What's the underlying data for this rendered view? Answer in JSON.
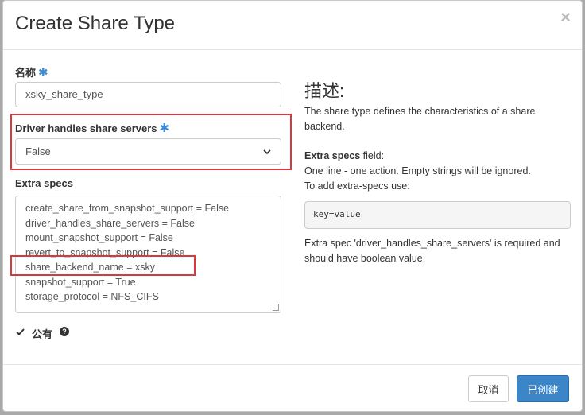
{
  "modal": {
    "title": "Create Share Type",
    "close_glyph": "×"
  },
  "form": {
    "name": {
      "label": "名称",
      "required_mark": "✱",
      "value": "xsky_share_type"
    },
    "driver_handles": {
      "label": "Driver handles share servers",
      "required_mark": "✱",
      "value": "False"
    },
    "extra_specs": {
      "label": "Extra specs",
      "lines": [
        "create_share_from_snapshot_support = False",
        "driver_handles_share_servers = False",
        "mount_snapshot_support = False",
        "revert_to_snapshot_support = False",
        "share_backend_name = xsky",
        "snapshot_support = True",
        "storage_protocol = NFS_CIFS"
      ]
    },
    "public": {
      "label": "公有",
      "checked_glyph": "☑",
      "help_glyph": "?"
    }
  },
  "help": {
    "title": "描述:",
    "intro": "The share type defines the characteristics of a share backend.",
    "extra_specs_bold": "Extra specs",
    "extra_specs_rest": " field:",
    "line1": "One line - one action. Empty strings will be ignored.",
    "line2": "To add extra-specs use:",
    "code_example": "key=value",
    "footer_note": "Extra spec 'driver_handles_share_servers' is required and should have boolean value."
  },
  "footer": {
    "cancel_label": "取消",
    "create_label": "已创建"
  },
  "colors": {
    "accent": "#3a86c8",
    "highlight_box": "#d9393c",
    "required": "#3b8bd6"
  }
}
